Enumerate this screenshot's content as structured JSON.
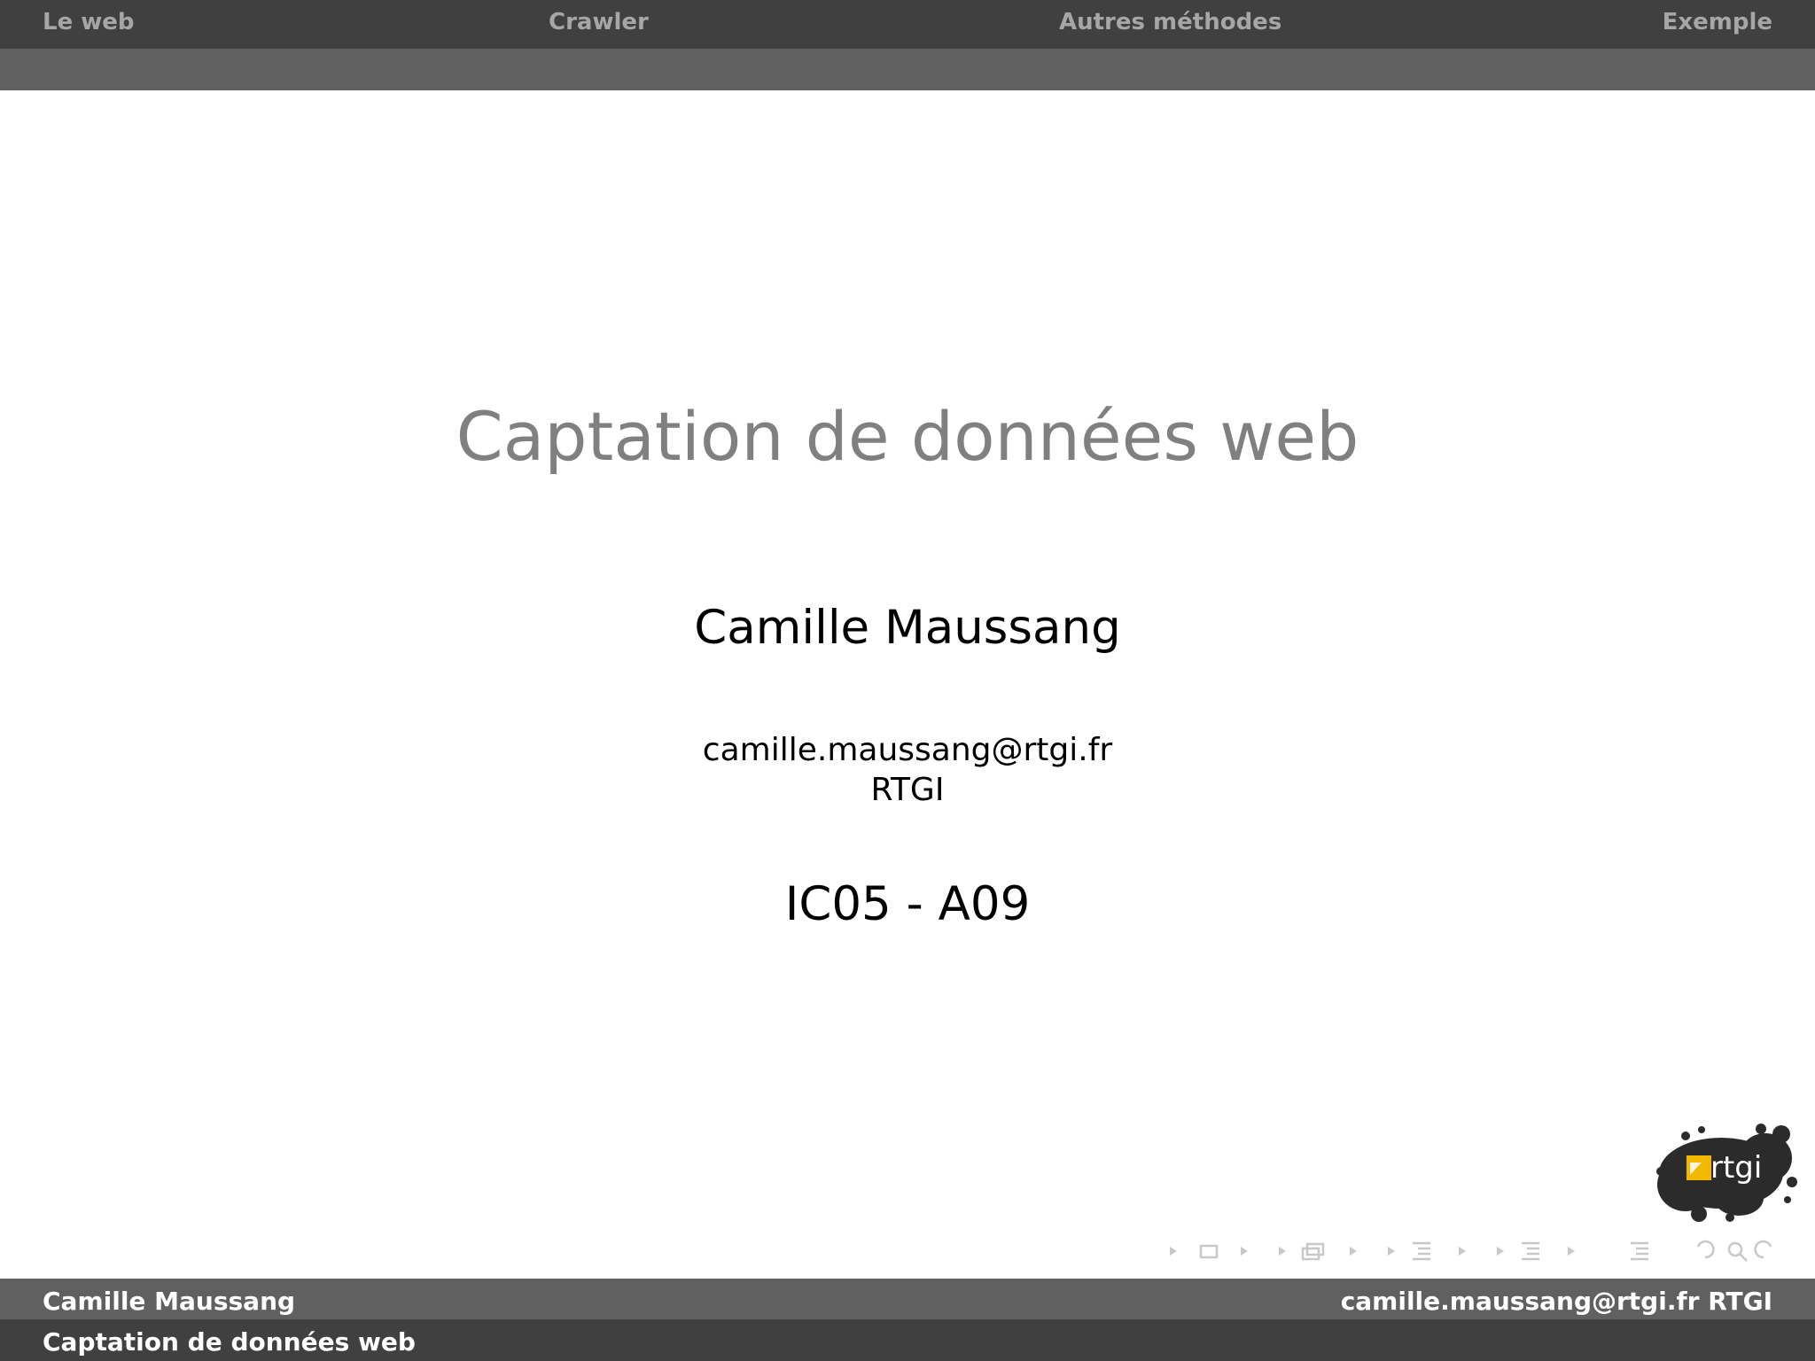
{
  "nav": {
    "sections": [
      "Le web",
      "Crawler",
      "Autres méthodes",
      "Exemple"
    ]
  },
  "title_page": {
    "title": "Captation de données web",
    "author": "Camille Maussang",
    "email": "camille.maussang@rtgi.fr",
    "institute": "RTGI",
    "date": "IC05 - A09"
  },
  "logo": {
    "text": "rtgi"
  },
  "footer": {
    "author": "Camille Maussang",
    "contact": "camille.maussang@rtgi.fr RTGI",
    "title": "Captation de données web"
  },
  "colors": {
    "bar_dark": "#404040",
    "bar_mid": "#606060",
    "nav_text": "#a6a6a6",
    "title_text": "#808080",
    "logo_yellow": "#f2b800"
  }
}
